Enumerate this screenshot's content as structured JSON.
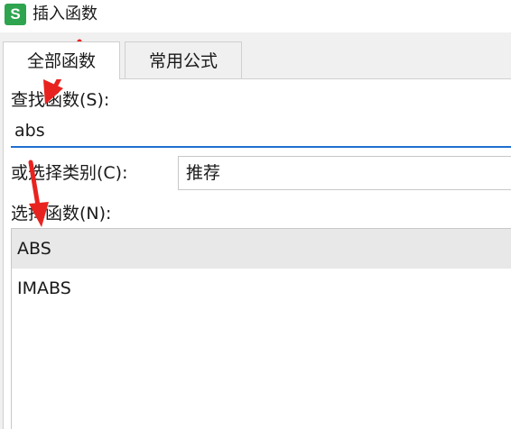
{
  "titlebar": {
    "icon_letter": "S",
    "title": "插入函数"
  },
  "tabs": [
    {
      "label": "全部函数",
      "active": true
    },
    {
      "label": "常用公式",
      "active": false
    }
  ],
  "search": {
    "label": "查找函数(S):",
    "value": "abs"
  },
  "category": {
    "label": "或选择类别(C):",
    "selected": "推荐"
  },
  "function_list": {
    "label": "选择函数(N):",
    "items": [
      {
        "name": "ABS",
        "selected": true
      },
      {
        "name": "IMABS",
        "selected": false
      }
    ]
  },
  "colors": {
    "accent": "#1f6fd0",
    "annotation_arrow": "#e8231f",
    "app_icon": "#2ea44f"
  }
}
